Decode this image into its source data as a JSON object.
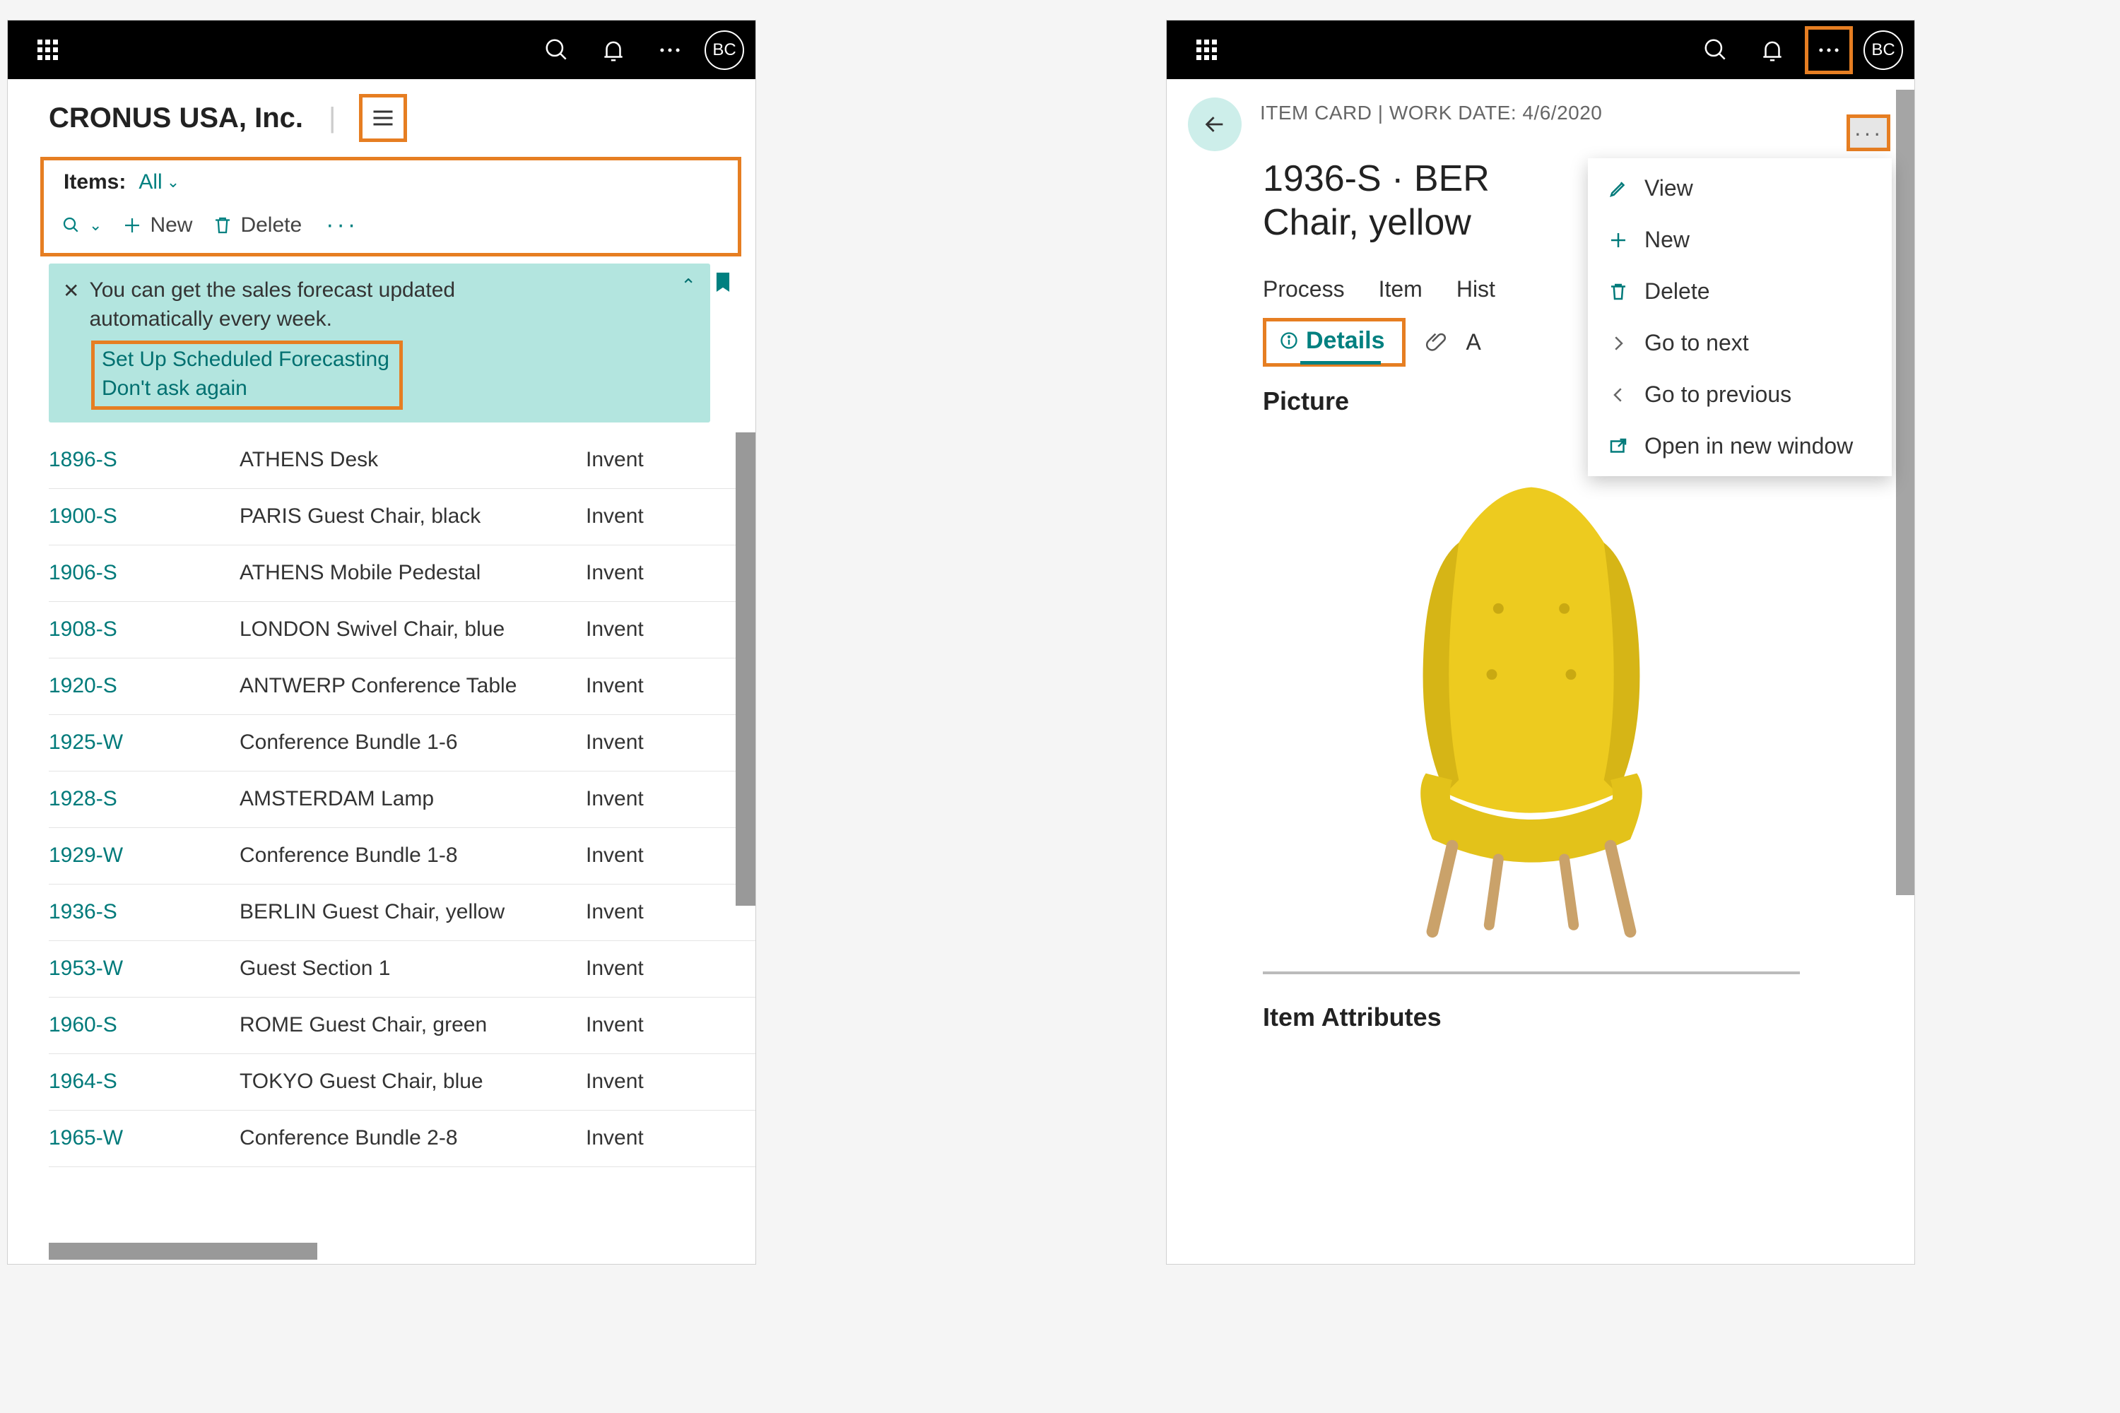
{
  "avatar_initials": "BC",
  "left": {
    "company": "CRONUS USA, Inc.",
    "items_label": "Items:",
    "items_filter": "All",
    "new_label": "New",
    "delete_label": "Delete",
    "notif_msg": "You can get the sales forecast updated automatically every week.",
    "notif_link1": "Set Up Scheduled Forecasting",
    "notif_link2": "Don't ask again",
    "rows": [
      {
        "no": "1896-S",
        "desc": "ATHENS Desk",
        "col3": "Invent"
      },
      {
        "no": "1900-S",
        "desc": "PARIS Guest Chair, black",
        "col3": "Invent"
      },
      {
        "no": "1906-S",
        "desc": "ATHENS Mobile Pedestal",
        "col3": "Invent"
      },
      {
        "no": "1908-S",
        "desc": "LONDON Swivel Chair, blue",
        "col3": "Invent"
      },
      {
        "no": "1920-S",
        "desc": "ANTWERP Conference Table",
        "col3": "Invent"
      },
      {
        "no": "1925-W",
        "desc": "Conference Bundle 1-6",
        "col3": "Invent"
      },
      {
        "no": "1928-S",
        "desc": "AMSTERDAM Lamp",
        "col3": "Invent"
      },
      {
        "no": "1929-W",
        "desc": "Conference Bundle 1-8",
        "col3": "Invent"
      },
      {
        "no": "1936-S",
        "desc": "BERLIN Guest Chair, yellow",
        "col3": "Invent"
      },
      {
        "no": "1953-W",
        "desc": "Guest Section 1",
        "col3": "Invent"
      },
      {
        "no": "1960-S",
        "desc": "ROME Guest Chair, green",
        "col3": "Invent"
      },
      {
        "no": "1964-S",
        "desc": "TOKYO Guest Chair, blue",
        "col3": "Invent"
      },
      {
        "no": "1965-W",
        "desc": "Conference Bundle 2-8",
        "col3": "Invent"
      }
    ]
  },
  "right": {
    "meta": "ITEM CARD | WORK DATE: 4/6/2020",
    "title1": "1936-S · BER",
    "title2": "Chair, yellow",
    "tabs": [
      "Process",
      "Item",
      "Hist"
    ],
    "details_label": "Details",
    "attach_letter": "A",
    "picture_h": "Picture",
    "attrs_h": "Item Attributes",
    "menu": [
      {
        "label": "View",
        "icon": "pencil"
      },
      {
        "label": "New",
        "icon": "plus"
      },
      {
        "label": "Delete",
        "icon": "trash"
      },
      {
        "label": "Go to next",
        "icon": "chev-right"
      },
      {
        "label": "Go to previous",
        "icon": "chev-left"
      },
      {
        "label": "Open in new window",
        "icon": "open-ext"
      }
    ]
  }
}
